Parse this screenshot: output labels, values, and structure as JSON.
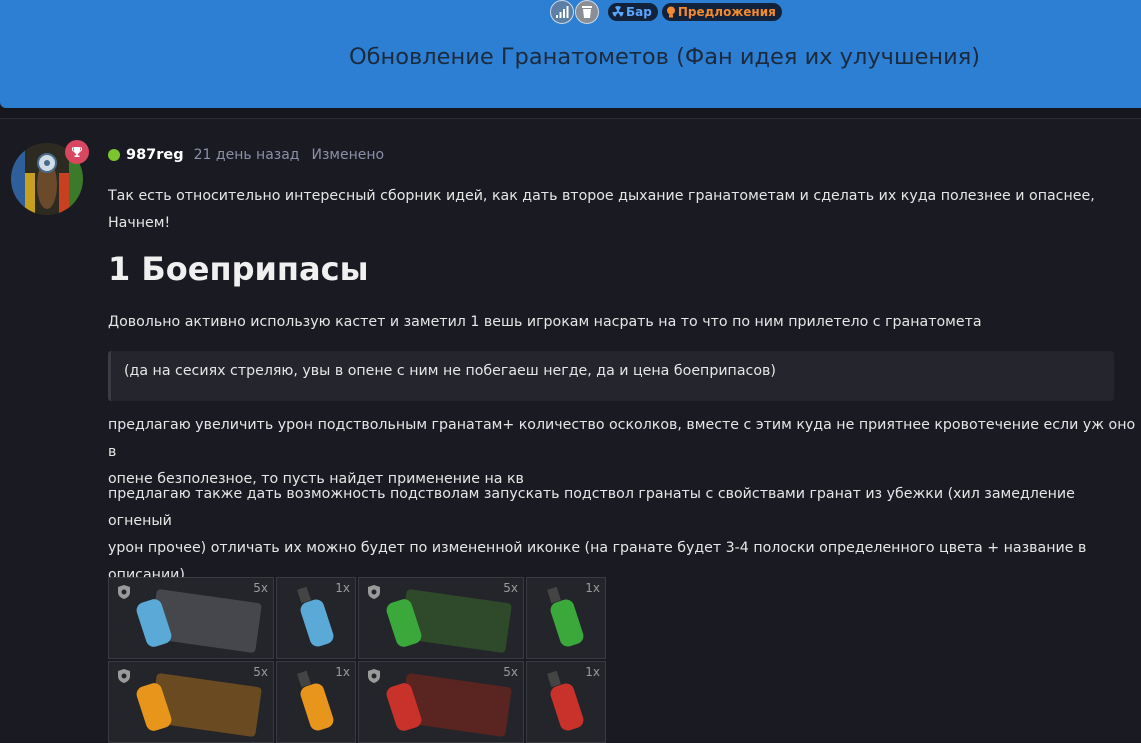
{
  "header": {
    "badge_bar": "Бар",
    "badge_offers": "Предложения",
    "title": "Обновление Гранатометов (Фан идея их улучшения)"
  },
  "post": {
    "username": "987reg",
    "time": "21 день назад",
    "edited": "Изменено",
    "intro": "Так есть относительно интересный сборник идей, как дать второе дыхание гранатометам и сделать их куда полезнее и опаснее, Начнем!",
    "heading": "1 Боеприпасы",
    "p1": "Довольно активно использую кастет и заметил 1 вешь игрокам насрать на то что по ним прилетело с гранатомета",
    "quote": "(да на сесиях стреляю, увы в опене с ним не побегаеш негде, да и цена боеприпасов)",
    "p2_line1": "предлагаю увеличить урон подствольным гранатам+ количество осколков, вместе с этим куда не приятнее кровотечение если уж оно в",
    "p2_line2": "опене безполезное, то пусть найдет применение на кв",
    "p3_line1": "предлагаю также дать возможность подстволам запускать подствол гранаты с свойствами гранат из убежки (хил замедление огненый",
    "p3_line2": "урон прочее) отличать их можно будет по измененной иконке (на гранате будет 3-4 полоски определенного цвета + название в",
    "p3_line3": "описании)"
  },
  "items": [
    {
      "count": "5x",
      "color": "#5aa9d6",
      "crate": "#3a3b40"
    },
    {
      "count": "1x",
      "color": "#5aa9d6"
    },
    {
      "count": "5x",
      "color": "#3aa83a",
      "crate": "#2f4a2a"
    },
    {
      "count": "1x",
      "color": "#3aa83a"
    },
    {
      "count": "5x",
      "color": "#e8951c",
      "crate": "#6a4a20"
    },
    {
      "count": "1x",
      "color": "#e8951c"
    },
    {
      "count": "5x",
      "color": "#c8322a",
      "crate": "#5a2420"
    },
    {
      "count": "1x",
      "color": "#c8322a"
    }
  ],
  "colors": {
    "header_bg": "#2c7fd3",
    "page_bg": "#16171c",
    "online": "#7bc62d",
    "trophy": "#d9465f"
  },
  "icons": [
    "signal-icon",
    "trash-icon",
    "radiation-icon",
    "lightbulb-icon",
    "trophy-icon",
    "shield-icon"
  ]
}
